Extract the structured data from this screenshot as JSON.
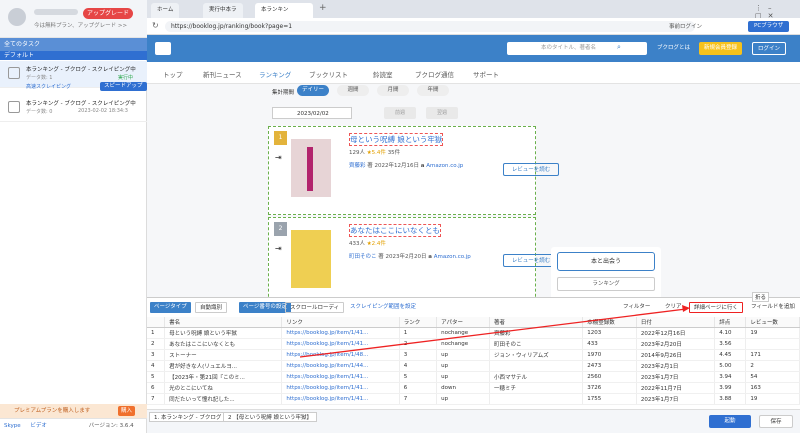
{
  "sidebar": {
    "upgrade": "アップグレード",
    "plan": "今は無料プラン、アップグレード >>",
    "tasks_header": "全てのタスク",
    "group": "デフォルト",
    "tasks": [
      {
        "name": "本ランキング - ブクログ - スクレイピング中",
        "sub": "データ数: 1",
        "status": "実行中",
        "mode": "高速スクレイピング",
        "speed": "スピードアップ"
      },
      {
        "name": "本ランキング - ブクログ - スクレイピング中",
        "sub": "データ数: 0",
        "date": "2023-02-02 18:34:3"
      }
    ],
    "premium": "プレミアムプランを購入します",
    "buy": "購入",
    "skype": "Skype",
    "lab": "ビデオ",
    "version": "バージョン: 3.6.4"
  },
  "browser": {
    "tabs": [
      "ホーム",
      "実行中本ラ",
      "本ランキン"
    ],
    "url": "https://booklog.jp/ranking/book?page=1",
    "login": "事前ログイン",
    "pc": "PCブラウザ"
  },
  "site": {
    "search_placeholder": "本のタイトル、著者名",
    "buttons": [
      "ブクログとは",
      "新規会員登録",
      "ログイン"
    ],
    "nav": [
      "トップ",
      "新刊ニュース",
      "ランキング",
      "ブックリスト",
      "鈴読室",
      "ブクログ通信",
      "サポート"
    ],
    "period_label": "集計期間",
    "periods": [
      "デイリー",
      "週間",
      "月間",
      "年間"
    ],
    "date": "2023/02/02",
    "prev": "前週",
    "next": "翌週",
    "books": [
      {
        "rank": "1",
        "title": "母という呪縛 娘という牢獄",
        "rating": "129人",
        "stars": "★5.4件",
        "reviews": "35件",
        "author": "齊藤彩",
        "date": "2022年12月16日",
        "store": "Amazon.co.jp",
        "review_btn": "レビューを読む"
      },
      {
        "rank": "2",
        "title": "あなたはここにいなくとも",
        "rating": "433人",
        "stars": "★2.4件",
        "author": "町田そのこ",
        "date": "2023年2月20日",
        "store": "Amazon.co.jp",
        "review_btn": "レビューを読む"
      }
    ],
    "panel_btn": "本と出会う",
    "panel_link": "ランキング"
  },
  "toolbar": {
    "page_type": "ページタイプ",
    "page_type_val": "自動識別",
    "page_no": "ページ番号の設定",
    "scroll": "スクロールローディ",
    "range": "スクレイピング範囲を設定",
    "filter": "フィルター",
    "clear": "クリア",
    "detail": "詳細ページに行く",
    "add_field": "フィールドを追加",
    "collapse": "折る"
  },
  "table": {
    "headers": [
      "",
      "書名",
      "リンク",
      "ランク",
      "アパター",
      "著者",
      "本棚登録数",
      "日付",
      "評点",
      "レビュー数"
    ],
    "rows": [
      [
        "1",
        "母という呪縛 娘という牢獄",
        "https://booklog.jp/item/1/41...",
        "1",
        "nochange",
        "齊藤彩",
        "1203",
        "2022年12月16日",
        "4.10",
        "19"
      ],
      [
        "2",
        "あなたはここにいなくとも",
        "https://booklog.jp/item/1/41...",
        "2",
        "nochange",
        "町田そのこ",
        "433",
        "2023年2月20日",
        "3.56",
        ""
      ],
      [
        "3",
        "ストーナー",
        "https://booklog.jp/item/1/48...",
        "3",
        "up",
        "ジョン・ウィリアムズ",
        "1970",
        "2014年9月26日",
        "4.45",
        "171"
      ],
      [
        "4",
        "君が好きな人(リュエルヨ...",
        "https://booklog.jp/item/1/44...",
        "4",
        "up",
        "",
        "2473",
        "2023年2月1日",
        "5.00",
        "2"
      ],
      [
        "5",
        "【2023年・第21回『このミ...",
        "https://booklog.jp/item/1/41...",
        "5",
        "up",
        "小西マサテル",
        "2560",
        "2023年1月7日",
        "3.94",
        "54"
      ],
      [
        "6",
        "光のとこにいてね",
        "https://booklog.jp/item/1/41...",
        "6",
        "down",
        "一穂ミチ",
        "3726",
        "2022年11月7日",
        "3.99",
        "163"
      ],
      [
        "7",
        "同だたいって憧れ記した...",
        "https://booklog.jp/item/1/41...",
        "7",
        "up",
        "",
        "1755",
        "2023年1月7日",
        "3.88",
        "19"
      ]
    ]
  },
  "bottom": {
    "tabs": [
      "1. 本ランキング - ブクログ",
      "2 【母という呪縛 娘という牢獄】"
    ],
    "run": "起動",
    "save": "保存"
  }
}
